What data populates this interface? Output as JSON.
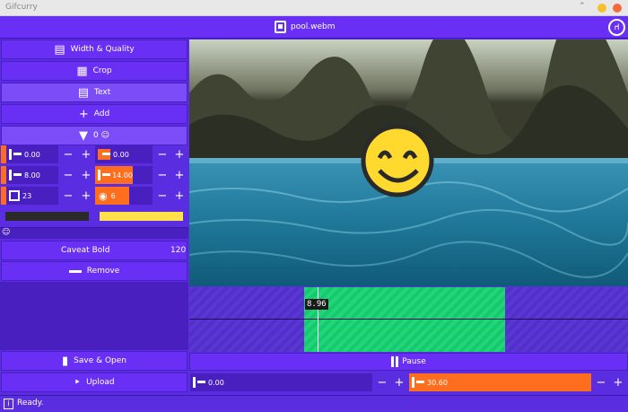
{
  "window": {
    "title": "Gifcurry"
  },
  "header": {
    "filename": "pool.webm",
    "logo": "⑁"
  },
  "sidebar": {
    "width_quality": "Width & Quality",
    "crop": "Crop",
    "text": "Text",
    "add": "Add",
    "text_index": "0 ☺",
    "fields": {
      "left1": "0.00",
      "right1": "0.00",
      "left2": "8.00",
      "right2": "14.00",
      "left3": "23",
      "right3": "6"
    },
    "emoji": "☺",
    "font_name": "Caveat Bold",
    "font_size": "120",
    "remove": "Remove",
    "save": "Save & Open",
    "upload": "Upload"
  },
  "colors": {
    "text_outline": "#2a2a2a",
    "text_fill": "#ffe14a",
    "accent": "#ff6d1f",
    "primary": "#6a2ff5"
  },
  "timeline": {
    "playhead_time": "8.96",
    "clip_start": "0.00",
    "clip_end": "30.60"
  },
  "controls": {
    "pause": "Pause"
  },
  "status": {
    "text": "Ready."
  }
}
